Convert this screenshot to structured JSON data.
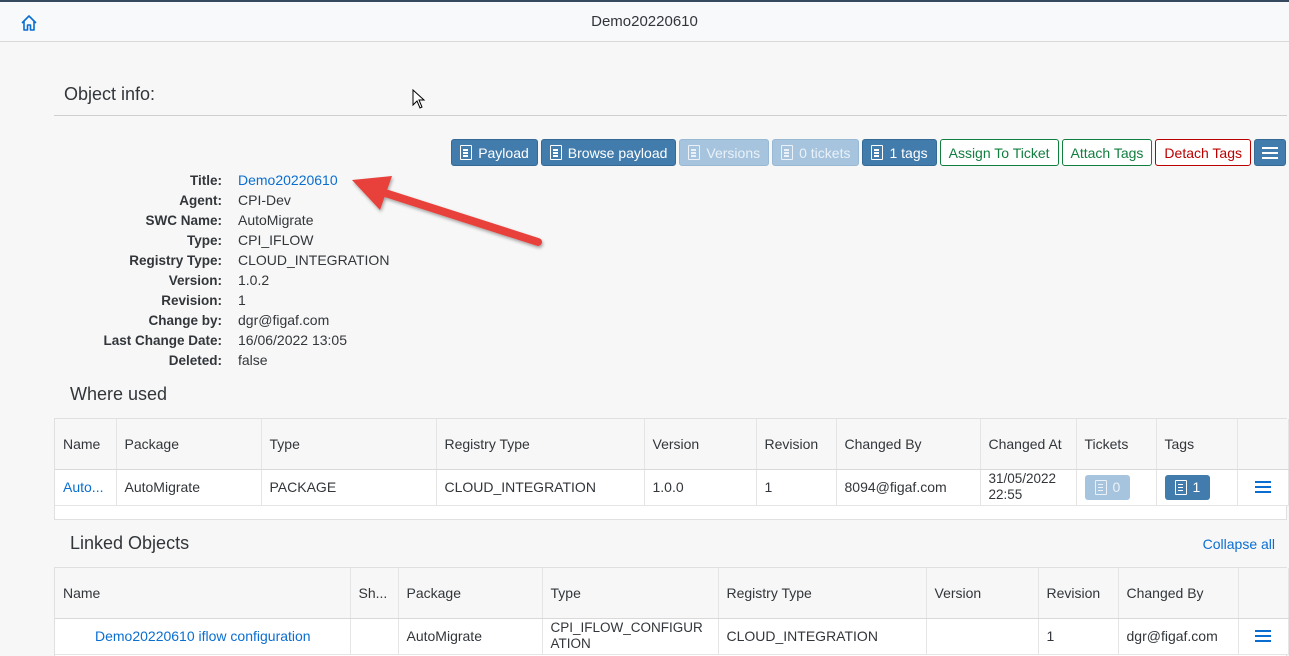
{
  "shell": {
    "title": "Demo20220610",
    "home_icon": "home-icon"
  },
  "object_info": {
    "heading": "Object info:"
  },
  "toolbar": {
    "payload": "Payload",
    "browse_payload": "Browse payload",
    "versions": "Versions",
    "tickets": "0 tickets",
    "tags": "1 tags",
    "assign_ticket": "Assign To Ticket",
    "attach_tags": "Attach Tags",
    "detach_tags": "Detach Tags"
  },
  "info": {
    "title_label": "Title:",
    "title_value": "Demo20220610",
    "agent_label": "Agent:",
    "agent_value": "CPI-Dev",
    "swc_label": "SWC Name:",
    "swc_value": "AutoMigrate",
    "type_label": "Type:",
    "type_value": "CPI_IFLOW",
    "registry_label": "Registry Type:",
    "registry_value": "CLOUD_INTEGRATION",
    "version_label": "Version:",
    "version_value": "1.0.2",
    "revision_label": "Revision:",
    "revision_value": "1",
    "changeby_label": "Change by:",
    "changeby_value": "dgr@figaf.com",
    "lastchange_label": "Last Change Date:",
    "lastchange_value": "16/06/2022 13:05",
    "deleted_label": "Deleted:",
    "deleted_value": "false"
  },
  "where_used": {
    "heading": "Where used",
    "columns": [
      "Name",
      "Package",
      "Type",
      "Registry Type",
      "Version",
      "Revision",
      "Changed By",
      "Changed At",
      "Tickets",
      "Tags",
      ""
    ],
    "rows": [
      {
        "name": "Auto...",
        "package": "AutoMigrate",
        "type": "PACKAGE",
        "registry_type": "CLOUD_INTEGRATION",
        "version": "1.0.0",
        "revision": "1",
        "changed_by": "8094@figaf.com",
        "changed_at": "31/05/2022 22:55",
        "tickets": "0",
        "tags": "1"
      }
    ]
  },
  "linked_objects": {
    "heading": "Linked Objects",
    "collapse_all": "Collapse all",
    "columns": [
      "Name",
      "Sh...",
      "Package",
      "Type",
      "Registry Type",
      "Version",
      "Revision",
      "Changed By",
      ""
    ],
    "rows": [
      {
        "name": "Demo20220610 iflow configuration",
        "sh": "",
        "package": "AutoMigrate",
        "type": "CPI_IFLOW_CONFIGURATION",
        "registry_type": "CLOUD_INTEGRATION",
        "version": "",
        "revision": "1",
        "changed_by": "dgr@figaf.com"
      }
    ]
  },
  "colors": {
    "primary": "#427cac",
    "link": "#0a6ed1",
    "accept": "#107e3e",
    "reject": "#bb0000",
    "annotation_arrow": "#e8413a"
  }
}
